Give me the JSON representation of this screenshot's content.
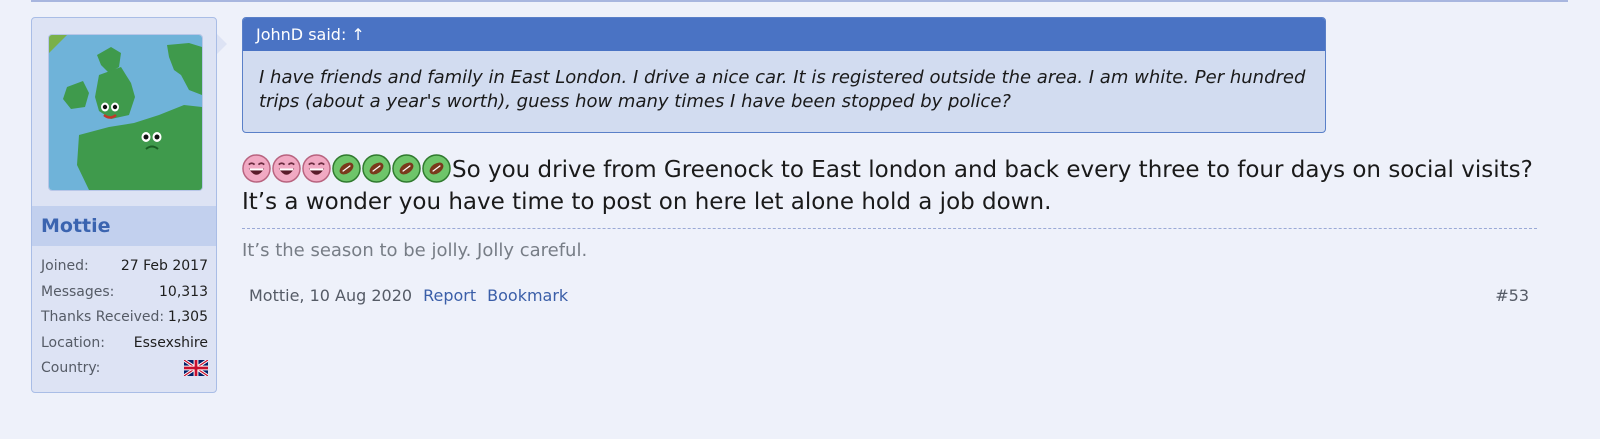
{
  "user": {
    "username": "Mottie",
    "stats": [
      {
        "label": "Joined:",
        "value": "27 Feb 2017"
      },
      {
        "label": "Messages:",
        "value": "10,313"
      },
      {
        "label": "Thanks Received:",
        "value": "1,305"
      },
      {
        "label": "Location:",
        "value": "Essexshire"
      },
      {
        "label": "Country:",
        "value": ""
      }
    ],
    "avatar_icon": "map-avatar-icon",
    "country_flag_icon": "uk-flag-icon"
  },
  "quote": {
    "header": "JohnD said: ↑",
    "text": "I have friends and family in East London. I drive a nice car. It is registered outside the area. I am white. Per hundred trips (about a year's worth), guess how many times I have been stopped by police?"
  },
  "post": {
    "emojis": [
      "laugh-icon",
      "laugh-icon",
      "laugh-icon",
      "ball-icon",
      "ball-icon",
      "ball-icon",
      "ball-icon"
    ],
    "text": "So you drive from Greenock to East london and back every three to four days on social visits? It’s a wonder you have time to post on here let alone hold a job down."
  },
  "signature": "It’s the season to be jolly. Jolly careful.",
  "footer": {
    "meta": "Mottie, 10 Aug 2020",
    "report_label": "Report",
    "bookmark_label": "Bookmark",
    "post_number": "#53"
  },
  "colors": {
    "accent": "#4a73c4",
    "username": "#3b64b0",
    "link": "#3a5ea8",
    "background": "#eef1fa"
  }
}
